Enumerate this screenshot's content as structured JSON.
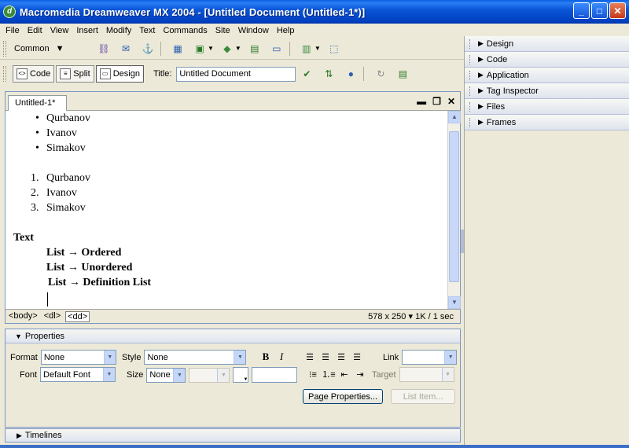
{
  "window": {
    "title": "Macromedia Dreamweaver MX 2004 - [Untitled Document (Untitled-1*)]",
    "app_icon_letter": "d"
  },
  "menu": [
    "File",
    "Edit",
    "View",
    "Insert",
    "Modify",
    "Text",
    "Commands",
    "Site",
    "Window",
    "Help"
  ],
  "insert_bar": {
    "category": "Common"
  },
  "doc_toolbar": {
    "code": "Code",
    "split": "Split",
    "design": "Design",
    "title_label": "Title:",
    "title_value": "Untitled Document"
  },
  "document": {
    "tab": "Untitled-1*",
    "unordered": [
      "Qurbanov",
      "Ivanov",
      "Simakov"
    ],
    "ordered_nums": [
      "1.",
      "2.",
      "3."
    ],
    "ordered": [
      "Qurbanov",
      "Ivanov",
      "Simakov"
    ],
    "heading": "Text",
    "lines": [
      "List → Ordered",
      "List → Unordered",
      "List → Definition List"
    ]
  },
  "doc_status": {
    "tags": [
      "<body>",
      "<dl>",
      "<dd>"
    ],
    "window_size": "578 x 250",
    "download": "1K / 1 sec"
  },
  "properties": {
    "title": "Properties",
    "format_label": "Format",
    "format_value": "None",
    "style_label": "Style",
    "style_value": "None",
    "link_label": "Link",
    "link_value": "",
    "font_label": "Font",
    "font_value": "Default Font",
    "size_label": "Size",
    "size_value": "None",
    "target_label": "Target",
    "bold": "B",
    "italic": "I",
    "page_properties": "Page Properties...",
    "list_item": "List Item..."
  },
  "timelines": "Timelines",
  "panels": [
    "Design",
    "Code",
    "Application",
    "Tag Inspector",
    "Files",
    "Frames"
  ]
}
